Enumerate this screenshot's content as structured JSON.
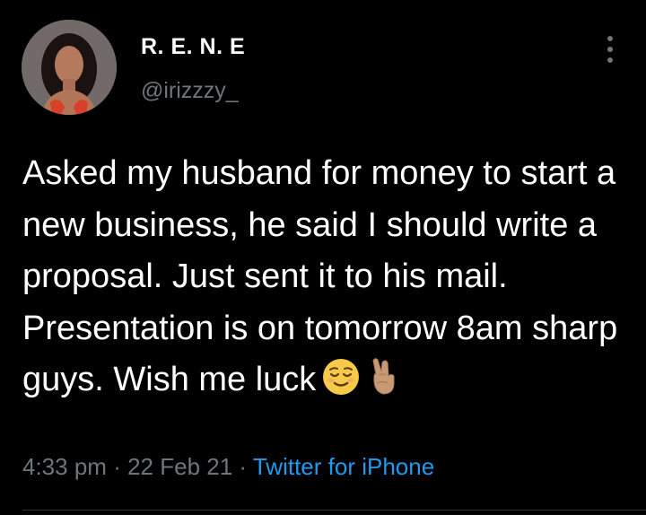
{
  "user": {
    "display_name": "R. E. N. E",
    "handle": "@irizzzy_"
  },
  "tweet": {
    "text": "Asked my husband for money to start a new business, he said I should write a proposal. Just sent it to his mail. Presentation is on tomorrow 8am sharp guys. Wish me luck",
    "emojis": [
      "relieved-face-emoji",
      "crossed-fingers-emoji"
    ],
    "time": "4:33 pm",
    "date": "22 Feb 21",
    "source": "Twitter for iPhone",
    "separator": "·"
  },
  "colors": {
    "background": "#000000",
    "text": "#ffffff",
    "muted": "#6e767d",
    "link": "#1d9bf0"
  },
  "icons": {
    "more": "vertical-ellipsis-icon"
  }
}
